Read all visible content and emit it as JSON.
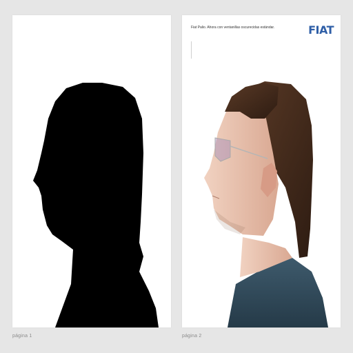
{
  "left_page": {
    "page_label": "página 1"
  },
  "right_page": {
    "headline": "Fiat Palio. Ahora con ventanillas oscurecidas estándar.",
    "brand_logo": "FIAT",
    "page_label": "página 2"
  },
  "colors": {
    "background": "#e6e6e6",
    "page": "#ffffff",
    "silhouette": "#000000",
    "brand": "#2f5fa7"
  }
}
